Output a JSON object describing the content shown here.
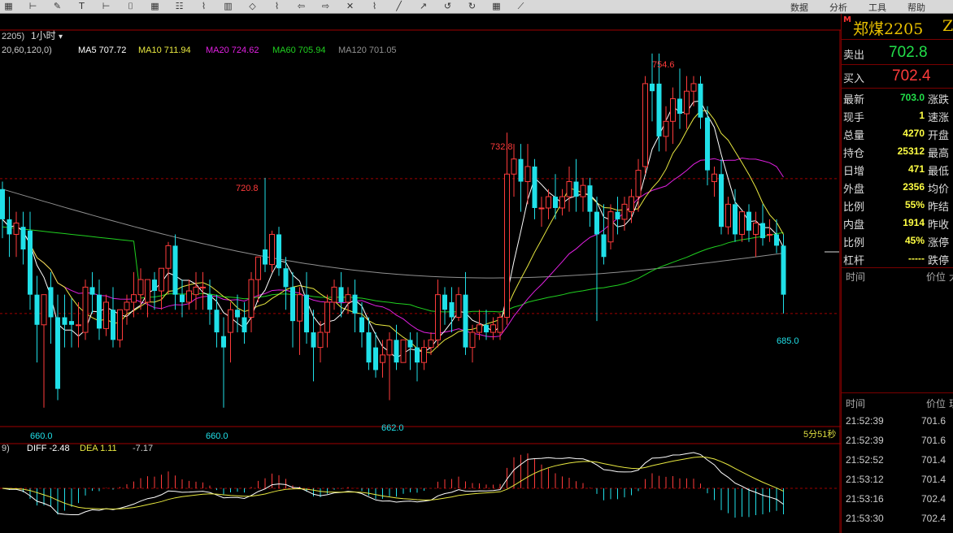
{
  "toolbar": {
    "icons": [
      "grid-icon",
      "ruler-icon",
      "pencil-icon",
      "text-icon",
      "ruler-icon",
      "bracket-icon",
      "grid-icon",
      "table-icon",
      "chart-icon",
      "bar-icon",
      "diamond-icon",
      "chart-icon",
      "arrow-left-icon",
      "arrow-right-icon",
      "cross-icon",
      "chart-icon",
      "line-icon",
      "cursor-icon",
      "undo-icon",
      "redo-icon",
      "grid-icon",
      "fan-icon"
    ],
    "right_labels": [
      "数据",
      "分析",
      "工具",
      "帮助"
    ]
  },
  "chart_header": {
    "period_selector": "1小时",
    "contract_code_partial": "2205)",
    "ma_params": "20,60,120,0)",
    "ma5": "MA5 707.72",
    "ma10": "MA10 711.94",
    "ma20": "MA20 724.62",
    "ma60": "MA60 705.94",
    "ma120": "MA120 701.05"
  },
  "annotations": {
    "high_a": "720.8",
    "high_b": "732.8",
    "high_c": "754.6",
    "low_a": "660.0",
    "low_b": "660.0",
    "low_c": "662.0",
    "last_low": "685.0",
    "countdown": "5分51秒"
  },
  "macd_header": {
    "prefix": "9)",
    "diff": "DIFF -2.48",
    "dea": "DEA 1.11",
    "macd": "-7.17"
  },
  "panel": {
    "title": "郑煤2205",
    "title_suffix": "ZC",
    "ask_label": "卖出",
    "ask_price": "702.8",
    "bid_label": "买入",
    "bid_price": "702.4",
    "stats": [
      {
        "label": "最新",
        "value": "703.0",
        "color": "#22e04a",
        "ext": "涨跌"
      },
      {
        "label": "现手",
        "value": "1",
        "color": "#ffff44",
        "ext": "速涨"
      },
      {
        "label": "总量",
        "value": "4270",
        "color": "#ffff44",
        "ext": "开盘"
      },
      {
        "label": "持仓",
        "value": "25312",
        "color": "#ffff44",
        "ext": "最高"
      },
      {
        "label": "日增",
        "value": "471",
        "color": "#ffff44",
        "ext": "最低"
      },
      {
        "label": "外盘",
        "value": "2356",
        "color": "#ffff44",
        "ext": "均价"
      },
      {
        "label": "比例",
        "value": "55%",
        "color": "#ffff44",
        "ext": "昨结"
      },
      {
        "label": "内盘",
        "value": "1914",
        "color": "#ffff44",
        "ext": "昨收"
      },
      {
        "label": "比例",
        "value": "45%",
        "color": "#ffff44",
        "ext": "涨停"
      },
      {
        "label": "杠杆",
        "value": "-----",
        "color": "#ffff44",
        "ext": "跌停"
      }
    ],
    "ticks_header_1": {
      "time": "时间",
      "price": "价位",
      "vol": "大"
    },
    "ticks_header_2": {
      "time": "时间",
      "price": "价位",
      "vol": "现"
    },
    "ticks": [
      {
        "time": "21:52:39",
        "price": "701.6"
      },
      {
        "time": "21:52:39",
        "price": "701.6"
      },
      {
        "time": "21:52:52",
        "price": "701.4"
      },
      {
        "time": "21:53:12",
        "price": "701.4"
      },
      {
        "time": "21:53:16",
        "price": "702.4"
      },
      {
        "time": "21:53:30",
        "price": "702.4"
      }
    ]
  },
  "colors": {
    "up": "#ff3b3b",
    "down": "#20e0e8",
    "ma5": "#ffffff",
    "ma10": "#e8e840",
    "ma20": "#e020e0",
    "ma60": "#20d020",
    "ma120": "#909090",
    "grid_red": "#a00000"
  },
  "chart_data": {
    "type": "candlestick",
    "ylim": [
      655,
      760
    ],
    "candles": [
      {
        "o": 718,
        "h": 720,
        "c": 710,
        "l": 705
      },
      {
        "o": 710,
        "h": 716,
        "c": 706,
        "l": 700
      },
      {
        "o": 706,
        "h": 712,
        "c": 709,
        "l": 700
      },
      {
        "o": 708,
        "h": 712,
        "c": 702,
        "l": 698
      },
      {
        "o": 707,
        "h": 712,
        "c": 690,
        "l": 686
      },
      {
        "o": 690,
        "h": 695,
        "c": 682,
        "l": 672
      },
      {
        "o": 682,
        "h": 690,
        "c": 690,
        "l": 660
      },
      {
        "o": 692,
        "h": 696,
        "c": 684,
        "l": 677
      },
      {
        "o": 684,
        "h": 690,
        "c": 665,
        "l": 662
      },
      {
        "o": 684,
        "h": 690,
        "c": 682,
        "l": 676
      },
      {
        "o": 683,
        "h": 689,
        "c": 682,
        "l": 676
      },
      {
        "o": 682,
        "h": 688,
        "c": 682,
        "l": 676
      },
      {
        "o": 680,
        "h": 694,
        "c": 692,
        "l": 678
      },
      {
        "o": 692,
        "h": 696,
        "c": 690,
        "l": 685
      },
      {
        "o": 690,
        "h": 694,
        "c": 681,
        "l": 678
      },
      {
        "o": 681,
        "h": 690,
        "c": 688,
        "l": 679
      },
      {
        "o": 686,
        "h": 692,
        "c": 678,
        "l": 676
      },
      {
        "o": 678,
        "h": 686,
        "c": 686,
        "l": 676
      },
      {
        "o": 686,
        "h": 690,
        "c": 688,
        "l": 682
      },
      {
        "o": 688,
        "h": 696,
        "c": 690,
        "l": 684
      },
      {
        "o": 690,
        "h": 697,
        "c": 694,
        "l": 686
      },
      {
        "o": 688,
        "h": 694,
        "c": 694,
        "l": 684
      },
      {
        "o": 694,
        "h": 696,
        "c": 691,
        "l": 686
      },
      {
        "o": 691,
        "h": 697,
        "c": 697,
        "l": 686
      },
      {
        "o": 697,
        "h": 704,
        "c": 703,
        "l": 690
      },
      {
        "o": 703,
        "h": 706,
        "c": 690,
        "l": 686
      },
      {
        "o": 690,
        "h": 694,
        "c": 688,
        "l": 684
      },
      {
        "o": 688,
        "h": 694,
        "c": 691,
        "l": 686
      },
      {
        "o": 690,
        "h": 696,
        "c": 692,
        "l": 686
      },
      {
        "o": 692,
        "h": 696,
        "c": 692,
        "l": 686
      },
      {
        "o": 690,
        "h": 694,
        "c": 686,
        "l": 682
      },
      {
        "o": 686,
        "h": 690,
        "c": 680,
        "l": 676
      },
      {
        "o": 679,
        "h": 684,
        "c": 676,
        "l": 660
      },
      {
        "o": 680,
        "h": 688,
        "c": 686,
        "l": 672
      },
      {
        "o": 686,
        "h": 690,
        "c": 684,
        "l": 680
      },
      {
        "o": 684,
        "h": 688,
        "c": 680,
        "l": 677
      },
      {
        "o": 684,
        "h": 696,
        "c": 694,
        "l": 680
      },
      {
        "o": 694,
        "h": 700,
        "c": 700,
        "l": 688
      },
      {
        "o": 702,
        "h": 721,
        "c": 698,
        "l": 696
      },
      {
        "o": 698,
        "h": 707,
        "c": 706,
        "l": 696
      },
      {
        "o": 706,
        "h": 708,
        "c": 697,
        "l": 695
      },
      {
        "o": 697,
        "h": 700,
        "c": 692,
        "l": 686
      },
      {
        "o": 692,
        "h": 696,
        "c": 683,
        "l": 676
      },
      {
        "o": 683,
        "h": 692,
        "c": 690,
        "l": 674
      },
      {
        "o": 690,
        "h": 696,
        "c": 680,
        "l": 677
      },
      {
        "o": 680,
        "h": 686,
        "c": 676,
        "l": 667
      },
      {
        "o": 676,
        "h": 683,
        "c": 680,
        "l": 672
      },
      {
        "o": 680,
        "h": 690,
        "c": 688,
        "l": 676
      },
      {
        "o": 688,
        "h": 694,
        "c": 692,
        "l": 686
      },
      {
        "o": 692,
        "h": 696,
        "c": 688,
        "l": 684
      },
      {
        "o": 688,
        "h": 692,
        "c": 690,
        "l": 685
      },
      {
        "o": 690,
        "h": 694,
        "c": 685,
        "l": 680
      },
      {
        "o": 684,
        "h": 688,
        "c": 680,
        "l": 676
      },
      {
        "o": 680,
        "h": 684,
        "c": 672,
        "l": 670
      },
      {
        "o": 676,
        "h": 680,
        "c": 670,
        "l": 668
      },
      {
        "o": 672,
        "h": 678,
        "c": 674,
        "l": 668
      },
      {
        "o": 674,
        "h": 680,
        "c": 678,
        "l": 662
      },
      {
        "o": 678,
        "h": 682,
        "c": 672,
        "l": 670
      },
      {
        "o": 672,
        "h": 678,
        "c": 678,
        "l": 672
      },
      {
        "o": 678,
        "h": 680,
        "c": 676,
        "l": 670
      },
      {
        "o": 676,
        "h": 680,
        "c": 672,
        "l": 667
      },
      {
        "o": 672,
        "h": 678,
        "c": 676,
        "l": 670
      },
      {
        "o": 676,
        "h": 680,
        "c": 678,
        "l": 674
      },
      {
        "o": 678,
        "h": 694,
        "c": 690,
        "l": 676
      },
      {
        "o": 690,
        "h": 692,
        "c": 686,
        "l": 682
      },
      {
        "o": 688,
        "h": 692,
        "c": 684,
        "l": 680
      },
      {
        "o": 684,
        "h": 692,
        "c": 690,
        "l": 683
      },
      {
        "o": 690,
        "h": 696,
        "c": 676,
        "l": 674
      },
      {
        "o": 676,
        "h": 682,
        "c": 680,
        "l": 672
      },
      {
        "o": 680,
        "h": 686,
        "c": 682,
        "l": 678
      },
      {
        "o": 682,
        "h": 686,
        "c": 680,
        "l": 678
      },
      {
        "o": 680,
        "h": 684,
        "c": 682,
        "l": 678
      },
      {
        "o": 680,
        "h": 685,
        "c": 684,
        "l": 678
      },
      {
        "o": 684,
        "h": 733,
        "c": 722,
        "l": 682
      },
      {
        "o": 722,
        "h": 730,
        "c": 726,
        "l": 716
      },
      {
        "o": 726,
        "h": 730,
        "c": 720,
        "l": 712
      },
      {
        "o": 720,
        "h": 730,
        "c": 724,
        "l": 714
      },
      {
        "o": 724,
        "h": 726,
        "c": 713,
        "l": 710
      },
      {
        "o": 713,
        "h": 716,
        "c": 713,
        "l": 708
      },
      {
        "o": 713,
        "h": 718,
        "c": 716,
        "l": 710
      },
      {
        "o": 716,
        "h": 722,
        "c": 713,
        "l": 710
      },
      {
        "o": 713,
        "h": 718,
        "c": 716,
        "l": 711
      },
      {
        "o": 716,
        "h": 724,
        "c": 720,
        "l": 712
      },
      {
        "o": 720,
        "h": 726,
        "c": 716,
        "l": 712
      },
      {
        "o": 716,
        "h": 721,
        "c": 719,
        "l": 712
      },
      {
        "o": 719,
        "h": 721,
        "c": 712,
        "l": 708
      },
      {
        "o": 712,
        "h": 716,
        "c": 706,
        "l": 683
      },
      {
        "o": 706,
        "h": 714,
        "c": 700,
        "l": 698
      },
      {
        "o": 704,
        "h": 714,
        "c": 712,
        "l": 702
      },
      {
        "o": 712,
        "h": 716,
        "c": 710,
        "l": 706
      },
      {
        "o": 710,
        "h": 716,
        "c": 714,
        "l": 707
      },
      {
        "o": 712,
        "h": 718,
        "c": 716,
        "l": 709
      },
      {
        "o": 716,
        "h": 726,
        "c": 723,
        "l": 712
      },
      {
        "o": 724,
        "h": 748,
        "c": 746,
        "l": 722
      },
      {
        "o": 746,
        "h": 754,
        "c": 744,
        "l": 736
      },
      {
        "o": 746,
        "h": 754,
        "c": 732,
        "l": 728
      },
      {
        "o": 732,
        "h": 740,
        "c": 736,
        "l": 728
      },
      {
        "o": 736,
        "h": 745,
        "c": 742,
        "l": 730
      },
      {
        "o": 742,
        "h": 750,
        "c": 738,
        "l": 734
      },
      {
        "o": 738,
        "h": 748,
        "c": 744,
        "l": 734
      },
      {
        "o": 744,
        "h": 748,
        "c": 746,
        "l": 740
      },
      {
        "o": 746,
        "h": 748,
        "c": 737,
        "l": 734
      },
      {
        "o": 737,
        "h": 740,
        "c": 723,
        "l": 719
      },
      {
        "o": 720,
        "h": 724,
        "c": 722,
        "l": 716
      },
      {
        "o": 722,
        "h": 726,
        "c": 708,
        "l": 706
      },
      {
        "o": 708,
        "h": 716,
        "c": 714,
        "l": 706
      },
      {
        "o": 714,
        "h": 718,
        "c": 706,
        "l": 704
      },
      {
        "o": 706,
        "h": 712,
        "c": 712,
        "l": 704
      },
      {
        "o": 712,
        "h": 714,
        "c": 707,
        "l": 704
      },
      {
        "o": 706,
        "h": 712,
        "c": 709,
        "l": 700
      },
      {
        "o": 709,
        "h": 714,
        "c": 705,
        "l": 703
      },
      {
        "o": 706,
        "h": 710,
        "c": 706,
        "l": 704
      },
      {
        "o": 706,
        "h": 710,
        "c": 703,
        "l": 701
      },
      {
        "o": 703,
        "h": 706,
        "c": 690,
        "l": 685
      }
    ]
  }
}
